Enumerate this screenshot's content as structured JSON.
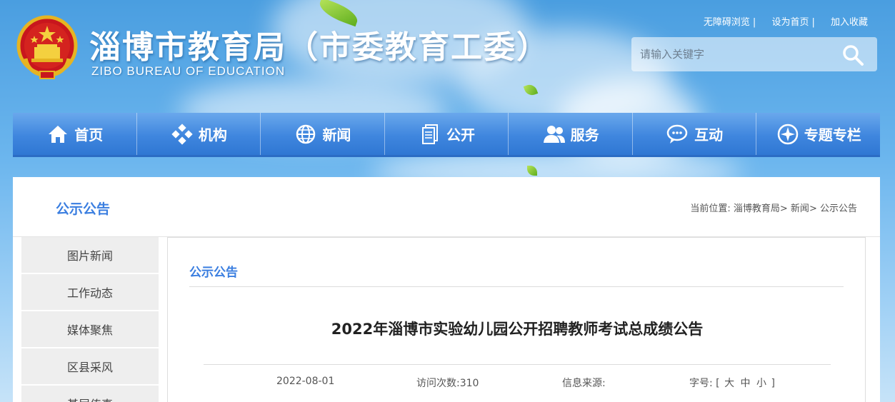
{
  "site": {
    "title": "淄博市教育局（市委教育工委）",
    "subtitle": "ZIBO BUREAU OF EDUCATION"
  },
  "toplinks": [
    "无障碍浏览",
    "设为首页",
    "加入收藏"
  ],
  "search": {
    "placeholder": "请输入关键字"
  },
  "nav": [
    {
      "label": "首页",
      "icon": "home-icon"
    },
    {
      "label": "机构",
      "icon": "organization-icon"
    },
    {
      "label": "新闻",
      "icon": "globe-icon"
    },
    {
      "label": "公开",
      "icon": "document-stack-icon"
    },
    {
      "label": "服务",
      "icon": "users-icon"
    },
    {
      "label": "互动",
      "icon": "chat-icon"
    },
    {
      "label": "专题专栏",
      "icon": "compass-icon"
    }
  ],
  "panel": {
    "title": "公示公告"
  },
  "breadcrumb": {
    "prefix": "当前位置:",
    "items": [
      "淄博教育局",
      "新闻",
      "公示公告"
    ],
    "separator": ">"
  },
  "sidebar": [
    "图片新闻",
    "工作动态",
    "媒体聚焦",
    "区县采风",
    "基层传真"
  ],
  "content": {
    "section_title": "公示公告",
    "article_title": "2022年淄博市实验幼儿园公开招聘教师考试总成绩公告",
    "meta": {
      "date": "2022-08-01",
      "visits": "访问次数:310",
      "source": "信息来源:",
      "font_label": "字号:",
      "font_open": "[",
      "font_large": "大",
      "font_medium": "中",
      "font_small": "小",
      "font_close": "]"
    }
  },
  "colors": {
    "accent": "#3a7ee0",
    "nav": "#3f86de"
  }
}
